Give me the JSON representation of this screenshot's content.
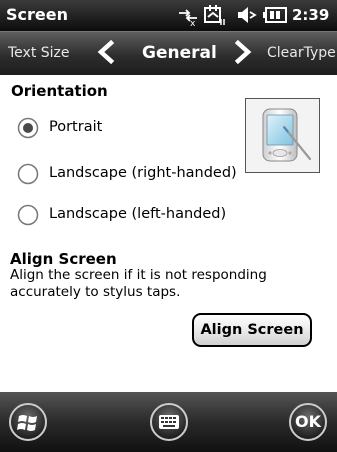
{
  "titlebar": {
    "title": "Screen",
    "time": "2:39",
    "status_icons": [
      "connectivity-icon",
      "data-sync-icon",
      "volume-icon",
      "battery-icon"
    ]
  },
  "tabs": {
    "previous": "Text Size",
    "current": "General",
    "next": "ClearType"
  },
  "orientation": {
    "heading": "Orientation",
    "options": [
      {
        "label": "Portrait",
        "selected": true
      },
      {
        "label": "Landscape (right-handed)",
        "selected": false
      },
      {
        "label": "Landscape (left-handed)",
        "selected": false
      }
    ]
  },
  "align": {
    "heading": "Align Screen",
    "description_line1": "Align the screen if it is not responding",
    "description_line2": "accurately to stylus taps.",
    "button_label": "Align Screen"
  },
  "softkeys": {
    "left_icon": "windows-start-icon",
    "center_icon": "keyboard-icon",
    "right_label": "OK"
  },
  "colors": {
    "bar_dark": "#111111",
    "text": "#000000",
    "accent_blue": "#5a7fb0"
  }
}
